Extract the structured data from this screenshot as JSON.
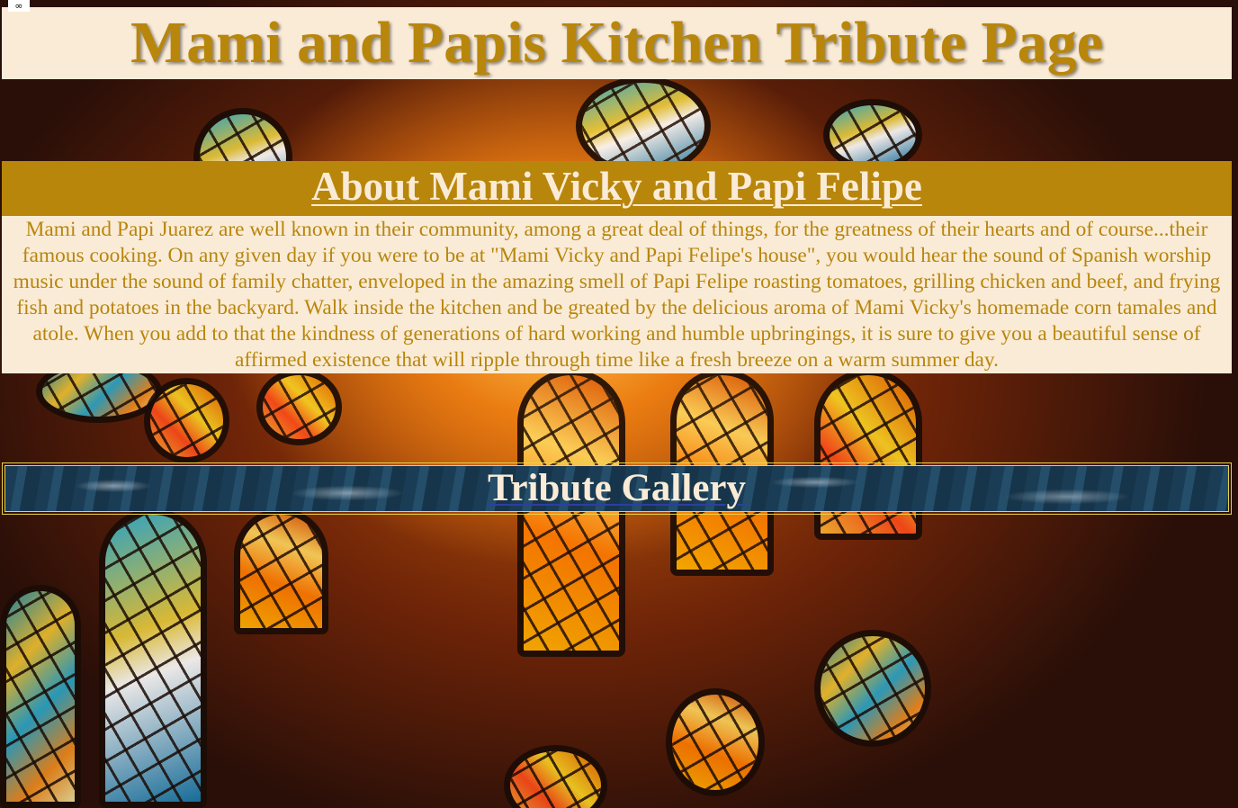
{
  "page": {
    "title": "Mami and Papis Kitchen Tribute Page",
    "corner_icon": "infinity-icon",
    "corner_glyph": "∞"
  },
  "about": {
    "heading": "About Mami Vicky and Papi Felipe",
    "text": "Mami and Papi Juarez are well known in their community, among a great deal of things, for the greatness of their hearts and of course...their famous cooking. On any given day if you were to be at \"Mami Vicky and Papi Felipe's house\", you would hear the sound of Spanish worship music under the sound of family chatter, enveloped in the amazing smell of Papi Felipe roasting tomatoes, grilling chicken and beef, and frying fish and potatoes in the backyard. Walk inside the kitchen and be greated by the delicious aroma of Mami Vicky's homemade corn tamales and atole. When you add to that the kindness of generations of hard working and humble upbringings, it is sure to give you a beautiful sense of affirmed existence that will ripple through time like a fresh breeze on a warm summer day."
  },
  "gallery": {
    "link_label": "Tribute Gallery"
  },
  "colors": {
    "title_text": "#b8860b",
    "title_bg": "#faebd7",
    "about_heading_bg": "#b8860b",
    "about_heading_text": "#faebd7",
    "gallery_border": "#e8d24a"
  }
}
